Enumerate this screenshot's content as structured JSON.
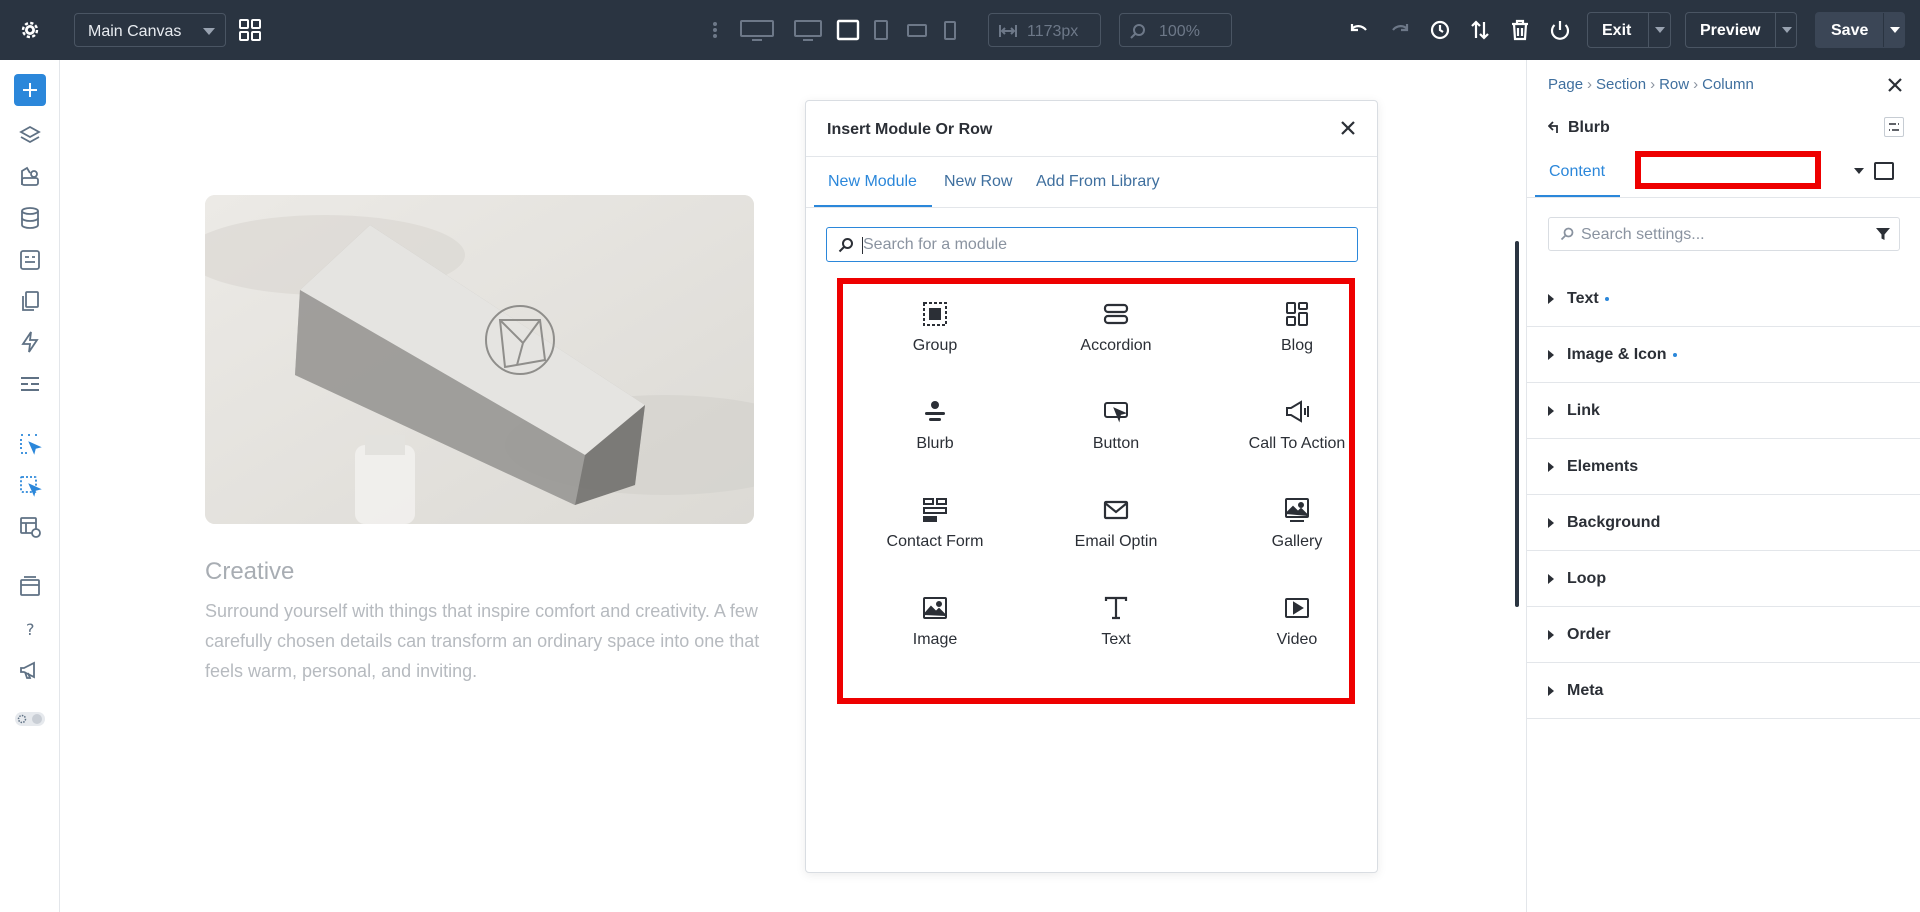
{
  "topbar": {
    "canvas_select": "Main Canvas",
    "width_value": "1173px",
    "zoom_value": "100%",
    "exit_label": "Exit",
    "preview_label": "Preview",
    "save_label": "Save"
  },
  "canvas": {
    "heading": "Creative",
    "body": "Surround yourself with things that inspire comfort and creativity. A few carefully chosen details can transform an ordinary space into one that feels warm, personal, and inviting."
  },
  "dialog": {
    "title": "Insert Module Or Row",
    "tabs": [
      "New Module",
      "New Row",
      "Add From Library"
    ],
    "search_placeholder": "Search for a module",
    "modules": [
      {
        "label": "Group",
        "icon": "group-icon"
      },
      {
        "label": "Accordion",
        "icon": "accordion-icon"
      },
      {
        "label": "Blog",
        "icon": "blog-icon"
      },
      {
        "label": "Blurb",
        "icon": "blurb-icon"
      },
      {
        "label": "Button",
        "icon": "button-icon"
      },
      {
        "label": "Call To Action",
        "icon": "call-to-action-icon"
      },
      {
        "label": "Contact Form",
        "icon": "contact-form-icon"
      },
      {
        "label": "Email Optin",
        "icon": "email-icon"
      },
      {
        "label": "Gallery",
        "icon": "gallery-icon"
      },
      {
        "label": "Image",
        "icon": "image-icon"
      },
      {
        "label": "Text",
        "icon": "text-icon"
      },
      {
        "label": "Video",
        "icon": "video-icon"
      }
    ]
  },
  "settings_panel": {
    "breadcrumb": [
      "Page",
      "Section",
      "Row",
      "Column"
    ],
    "module_title": "Blurb",
    "tab_content": "Content",
    "search_placeholder": "Search settings...",
    "groups": [
      {
        "label": "Text",
        "modified": true
      },
      {
        "label": "Image & Icon",
        "modified": true
      },
      {
        "label": "Link",
        "modified": false
      },
      {
        "label": "Elements",
        "modified": false
      },
      {
        "label": "Background",
        "modified": false
      },
      {
        "label": "Loop",
        "modified": false
      },
      {
        "label": "Order",
        "modified": false
      },
      {
        "label": "Meta",
        "modified": false
      }
    ]
  },
  "colors": {
    "topbar_bg": "#2a3441",
    "accent": "#2b87da",
    "highlight_red": "#ee0000"
  }
}
